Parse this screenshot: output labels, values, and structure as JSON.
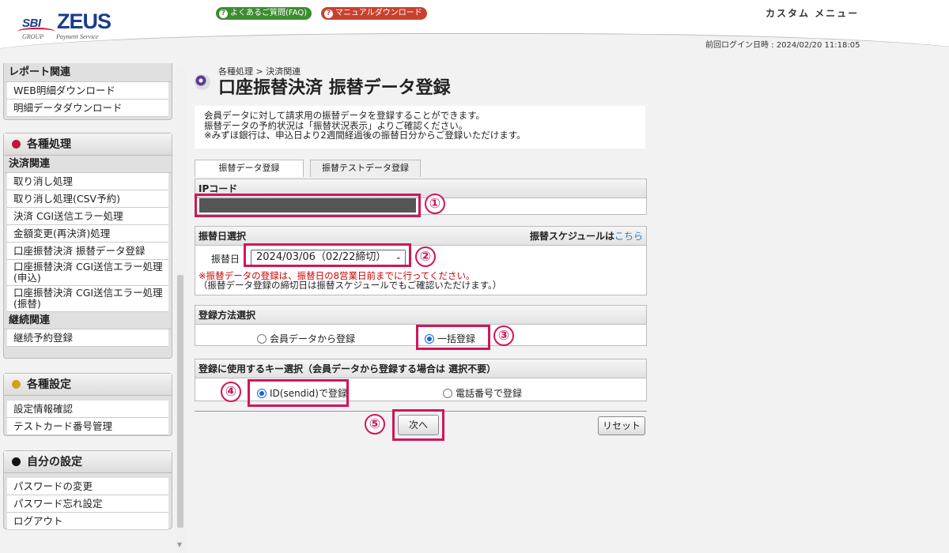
{
  "header": {
    "logo_sbi": "SBI",
    "logo_group": "GROUP",
    "logo_zeus": "ZEUS",
    "logo_payment": "Payment Service",
    "faq_label": "よくあるご質問(FAQ)",
    "manual_label": "マニュアルダウンロード",
    "custom_menu": "カスタム メニュー",
    "last_login": "前回ログイン日時 : 2024/02/20 11:18:05"
  },
  "sidebar": {
    "report_panel": {
      "title": "レポート関連",
      "items": [
        "WEB明細ダウンロード",
        "明細データダウンロード"
      ]
    },
    "processing_panel": {
      "title": "各種処理",
      "dot_color": "#c0143c",
      "groups": [
        {
          "head": "決済関連",
          "items": [
            "取り消し処理",
            "取り消し処理(CSV予約)",
            "決済 CGI送信エラー処理",
            "金額変更(再決済)処理",
            "口座振替決済 振替データ登録",
            "口座振替決済 CGI送信エラー処理(申込)",
            "口座振替決済 CGI送信エラー処理(振替)"
          ]
        },
        {
          "head": "継続関連",
          "items": [
            "継続予約登録"
          ]
        }
      ]
    },
    "settings_panel": {
      "title": "各種設定",
      "dot_color": "#d4a017",
      "items": [
        "設定情報確認",
        "テストカード番号管理"
      ]
    },
    "my_panel": {
      "title": "自分の設定",
      "dot_color": "#111111",
      "items": [
        "パスワードの変更",
        "パスワード忘れ設定",
        "ログアウト"
      ]
    }
  },
  "main": {
    "breadcrumb": "各種処理 > 決済関連",
    "title": "口座振替決済 振替データ登録",
    "notice": [
      "会員データに対して請求用の振替データを登録することができます。",
      "振替データの予約状況は「振替状況表示」よりご確認ください。",
      "※みずほ銀行は、申込日より2週間経過後の振替日分からご登録いただけます。"
    ],
    "tabs": [
      "振替データ登録",
      "振替テストデータ登録"
    ],
    "ip_section": {
      "label": "IPコード"
    },
    "date_section": {
      "label": "振替日選択",
      "schedule_text": "振替スケジュールは",
      "schedule_link": "こちら",
      "field_label": "振替日",
      "selected": "2024/03/06（02/22締切）",
      "warning": "※振替データの登録は、振替日の8営業日前までに行ってください。",
      "note": "（振替データ登録の締切日は振替スケジュールでもご確認いただけます。）"
    },
    "method_section": {
      "label": "登録方法選択",
      "option_member": "会員データから登録",
      "option_bulk": "一括登録"
    },
    "key_section": {
      "label": "登録に使用するキー選択（会員データから登録する場合は 選択不要）",
      "option_id": "ID(sendid)で登録",
      "option_phone": "電話番号で登録"
    },
    "next_button": "次へ",
    "reset_button": "リセット"
  },
  "annotations": [
    "①",
    "②",
    "③",
    "④",
    "⑤"
  ],
  "colors": {
    "annotation": "#d0155d",
    "accent": "#1a3e8c",
    "warning": "#cc0000"
  }
}
